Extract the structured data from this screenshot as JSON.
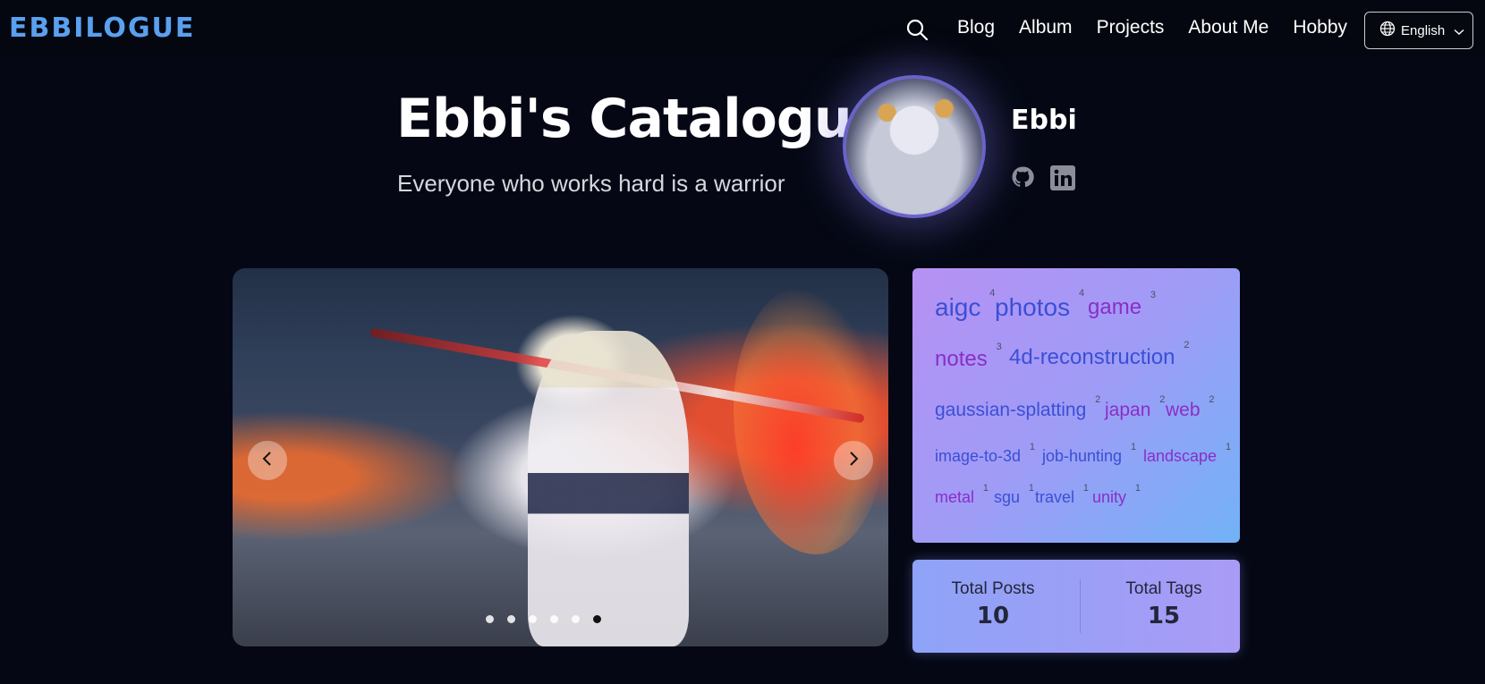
{
  "nav": {
    "logo": "EBBILOGUE",
    "links": [
      "Blog",
      "Album",
      "Projects",
      "About Me",
      "Hobby"
    ],
    "language": "English"
  },
  "hero": {
    "title": "Ebbi's Catalogue",
    "subtitle": "Everyone who works hard is a warrior"
  },
  "profile": {
    "name": "Ebbi",
    "social": [
      "github-icon",
      "linkedin-icon"
    ]
  },
  "carousel": {
    "slide_count": 6,
    "active_index": 5
  },
  "tags": [
    {
      "name": "aigc",
      "count": "4"
    },
    {
      "name": "photos",
      "count": "4"
    },
    {
      "name": "game",
      "count": "3"
    },
    {
      "name": "notes",
      "count": "3"
    },
    {
      "name": "4d-reconstruction",
      "count": "2"
    },
    {
      "name": "gaussian-splatting",
      "count": "2"
    },
    {
      "name": "japan",
      "count": "2"
    },
    {
      "name": "web",
      "count": "2"
    },
    {
      "name": "image-to-3d",
      "count": "1"
    },
    {
      "name": "job-hunting",
      "count": "1"
    },
    {
      "name": "landscape",
      "count": "1"
    },
    {
      "name": "metal",
      "count": "1"
    },
    {
      "name": "sgu",
      "count": "1"
    },
    {
      "name": "travel",
      "count": "1"
    },
    {
      "name": "unity",
      "count": "1"
    }
  ],
  "stats": {
    "posts_label": "Total Posts",
    "posts_value": "10",
    "tags_label": "Total Tags",
    "tags_value": "15"
  },
  "colors": {
    "background": "#050814",
    "logo": "#5aa0f0",
    "tag_blue": "#3a4fd6",
    "tag_purple": "#8a2ec8"
  }
}
